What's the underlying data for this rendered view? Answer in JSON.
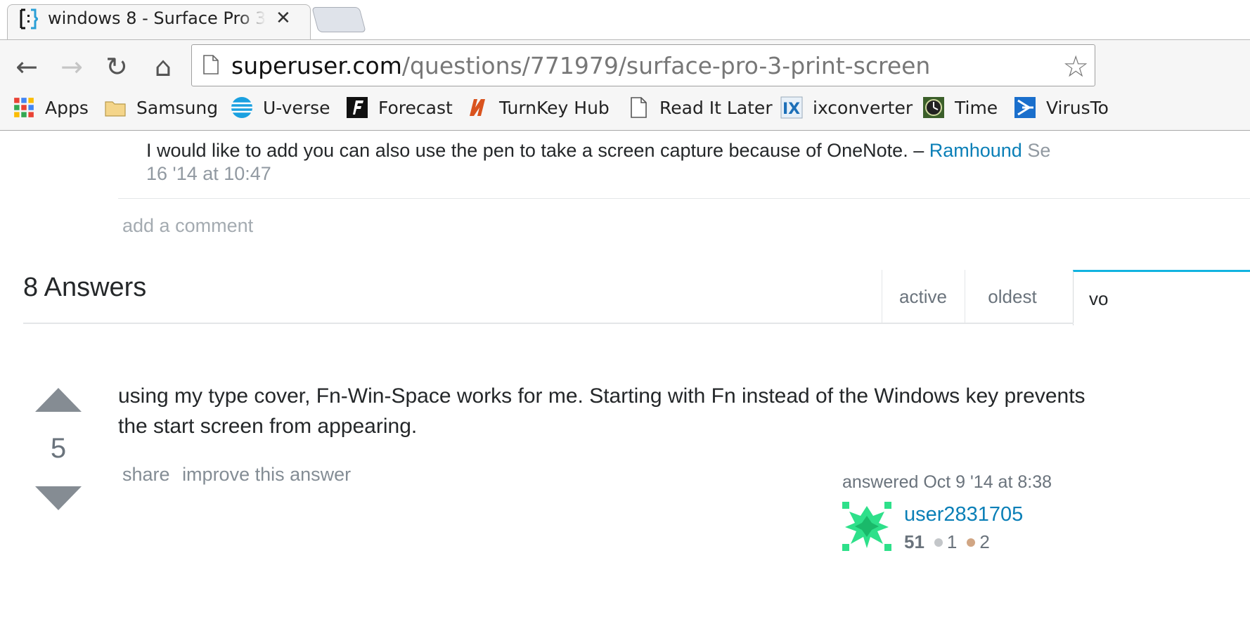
{
  "browser": {
    "tab": {
      "title": "windows 8 - Surface Pro 3",
      "close_glyph": "✕"
    },
    "nav": {
      "back": "←",
      "forward": "→",
      "reload": "↻",
      "home": "⌂"
    },
    "url": {
      "host": "superuser.com",
      "path": "/questions/771979/surface-pro-3-print-screen"
    },
    "bookmarks": [
      {
        "label": "Apps",
        "icon": "apps-grid-icon"
      },
      {
        "label": "Samsung",
        "icon": "folder-icon"
      },
      {
        "label": "U-verse",
        "icon": "att-globe-icon"
      },
      {
        "label": "Forecast",
        "icon": "forecast-f-icon"
      },
      {
        "label": "TurnKey Hub",
        "icon": "turnkey-icon"
      },
      {
        "label": "Read It Later",
        "icon": "page-icon"
      },
      {
        "label": "ixconverter",
        "icon": "ix-icon"
      },
      {
        "label": "Time",
        "icon": "time-icon"
      },
      {
        "label": "VirusTo",
        "icon": "virustotal-icon"
      }
    ]
  },
  "comment": {
    "text": "I would like to add you can also use the pen to take a screen capture because of OneNote. – ",
    "user": "Ramhound",
    "date_start": " Se",
    "date_end": "16 '14 at 10:47"
  },
  "add_comment": "add a comment",
  "answers": {
    "header": "8 Answers",
    "sort_tabs": [
      "active",
      "oldest",
      "vo"
    ]
  },
  "answer": {
    "votes": "5",
    "body": "using my type cover, Fn-Win-Space works for me. Starting with Fn instead of the Windows key prevents the start screen from appearing.",
    "menu": {
      "share": "share",
      "improve": "improve this answer"
    },
    "answered": "answered Oct 9 '14 at 8:38",
    "user": {
      "name": "user2831705",
      "rep": "51",
      "silver": "1",
      "bronze": "2"
    }
  },
  "colors": {
    "link": "#0a7fb7",
    "sort_accent": "#12b3e0",
    "silver": "#c3c6c9",
    "bronze": "#d1a684"
  }
}
